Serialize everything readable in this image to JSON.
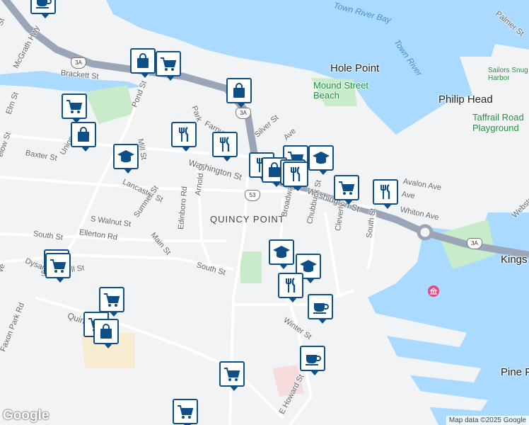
{
  "map": {
    "colors": {
      "water": "#aadaff",
      "land": "#f1f3f4",
      "park": "#c8ebc9",
      "highway": "#9aa6b8",
      "pin_border": "#0d4f86"
    },
    "water_labels": [
      "Town River Bay",
      "Town River"
    ],
    "places": [
      "Hole Point",
      "Philip Head",
      "Pine P",
      "Kings"
    ],
    "parks": [
      "Mound Street Beach",
      "Sailors Snug Harbor",
      "Taffrail Road Playground"
    ],
    "area": "QUINCY POINT",
    "streets": [
      "Palmer St",
      "McGrath Hwy",
      "Brackett St",
      "Pond St",
      "Elm St",
      "Mill St",
      "Baxter St",
      "Union St",
      "Lancaster St",
      "Park",
      "Farnum St",
      "Silver St",
      "Ave",
      "Washington St",
      "Washington St",
      "Arnold St",
      "Sumner St",
      "S Walnut St",
      "Ellerton Rd",
      "Main St",
      "Edinboro Rd",
      "South St",
      "Dysart St",
      "Scammell St",
      "Broadway",
      "Chubbuck St",
      "Cleverly Ct",
      "South St",
      "Avalon Ave",
      "Ave",
      "Whiton Ave",
      "Quincy Ave",
      "Faxon Park Rd",
      "Winter St",
      "E Howard St",
      "Webster St",
      "St",
      "elow St",
      "ve",
      "South St"
    ],
    "routes": [
      "3A",
      "3A",
      "53",
      "3A"
    ],
    "pins": [
      {
        "type": "cafe"
      },
      {
        "type": "shop"
      },
      {
        "type": "grocery"
      },
      {
        "type": "shop"
      },
      {
        "type": "grocery"
      },
      {
        "type": "shop"
      },
      {
        "type": "restaurant"
      },
      {
        "type": "restaurant"
      },
      {
        "type": "school"
      },
      {
        "type": "restaurant"
      },
      {
        "type": "grocery"
      },
      {
        "type": "shop"
      },
      {
        "type": "restaurant"
      },
      {
        "type": "school"
      },
      {
        "type": "restaurant"
      },
      {
        "type": "grocery"
      },
      {
        "type": "restaurant"
      },
      {
        "type": "grocery"
      },
      {
        "type": "grocery"
      },
      {
        "type": "school"
      },
      {
        "type": "school"
      },
      {
        "type": "restaurant"
      },
      {
        "type": "cafe"
      },
      {
        "type": "grocery"
      },
      {
        "type": "grocery"
      },
      {
        "type": "shop"
      },
      {
        "type": "cafe"
      },
      {
        "type": "grocery"
      },
      {
        "type": "grocery"
      }
    ]
  },
  "footer": {
    "logo": "Google",
    "attribution": "Map data ©2025 Google"
  }
}
